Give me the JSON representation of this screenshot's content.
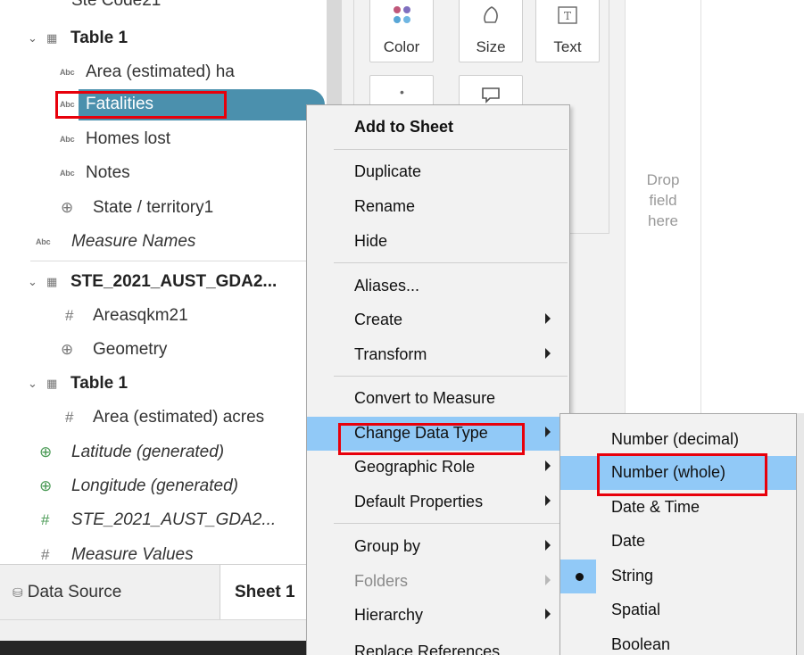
{
  "data_pane": {
    "clipped_top_label": "Ste Code21",
    "items": [
      {
        "kind": "table",
        "label": "Table 1",
        "type_icon": "table-icon"
      },
      {
        "kind": "dim",
        "label": "Area (estimated) ha",
        "type_icon": "Abc"
      },
      {
        "kind": "dim-selected",
        "label": "Fatalities",
        "type_icon": "Abc"
      },
      {
        "kind": "dim",
        "label": "Homes lost",
        "type_icon": "Abc"
      },
      {
        "kind": "dim",
        "label": "Notes",
        "type_icon": "Abc"
      },
      {
        "kind": "geo",
        "label": "State / territory1",
        "type_icon": "globe-icon"
      },
      {
        "kind": "special",
        "label": "Measure Names",
        "type_icon": "Abc"
      },
      {
        "kind": "table",
        "label": "STE_2021_AUST_GDA2...",
        "type_icon": "table-icon"
      },
      {
        "kind": "measure",
        "label": "Areasqkm21",
        "type_icon": "#"
      },
      {
        "kind": "geo",
        "label": "Geometry",
        "type_icon": "globe-icon"
      },
      {
        "kind": "table",
        "label": "Table 1",
        "type_icon": "table-icon"
      },
      {
        "kind": "measure",
        "label": "Area (estimated) acres",
        "type_icon": "#"
      },
      {
        "kind": "generated",
        "label": "Latitude (generated)",
        "type_icon": "globe-icon"
      },
      {
        "kind": "generated",
        "label": "Longitude (generated)",
        "type_icon": "globe-icon"
      },
      {
        "kind": "special-measure",
        "label": "STE_2021_AUST_GDA2...",
        "type_icon": "#"
      },
      {
        "kind": "special-measure",
        "label": "Measure Values",
        "type_icon": "#"
      }
    ]
  },
  "marks_card": {
    "buttons": [
      {
        "label": "Color",
        "icon": "color-dots-icon"
      },
      {
        "label": "Size",
        "icon": "size-icon"
      },
      {
        "label": "Text",
        "icon": "text-icon"
      },
      {
        "label": "",
        "icon": "detail-icon"
      },
      {
        "label": "",
        "icon": "tooltip-icon"
      }
    ]
  },
  "drop_zone": {
    "line1": "Drop",
    "line2": "field",
    "line3": "here"
  },
  "tabs": {
    "data_source": "Data Source",
    "sheet": "Sheet 1"
  },
  "context_menu": {
    "items": [
      {
        "label": "Add to Sheet",
        "bold": true,
        "submenu": false
      },
      {
        "label": "Duplicate",
        "submenu": false
      },
      {
        "label": "Rename",
        "submenu": false
      },
      {
        "label": "Hide",
        "submenu": false
      },
      {
        "label": "Aliases...",
        "submenu": false
      },
      {
        "label": "Create",
        "submenu": true
      },
      {
        "label": "Transform",
        "submenu": true
      },
      {
        "label": "Convert to Measure",
        "submenu": false
      },
      {
        "label": "Change Data Type",
        "submenu": true,
        "highlighted": true
      },
      {
        "label": "Geographic Role",
        "submenu": true
      },
      {
        "label": "Default Properties",
        "submenu": true
      },
      {
        "label": "Group by",
        "submenu": true
      },
      {
        "label": "Folders",
        "submenu": true,
        "disabled": true
      },
      {
        "label": "Hierarchy",
        "submenu": true
      },
      {
        "label": "Replace References...",
        "submenu": false
      }
    ]
  },
  "data_type_submenu": {
    "items": [
      {
        "label": "Number (decimal)"
      },
      {
        "label": "Number (whole)",
        "highlighted": true
      },
      {
        "label": "Date & Time"
      },
      {
        "label": "Date"
      },
      {
        "label": "String",
        "checked": true
      },
      {
        "label": "Spatial"
      },
      {
        "label": "Boolean"
      }
    ]
  },
  "colors": {
    "menu_highlight": "#91c9f7",
    "selected_field": "#4b90ad",
    "annotation_red": "#e8000b"
  }
}
